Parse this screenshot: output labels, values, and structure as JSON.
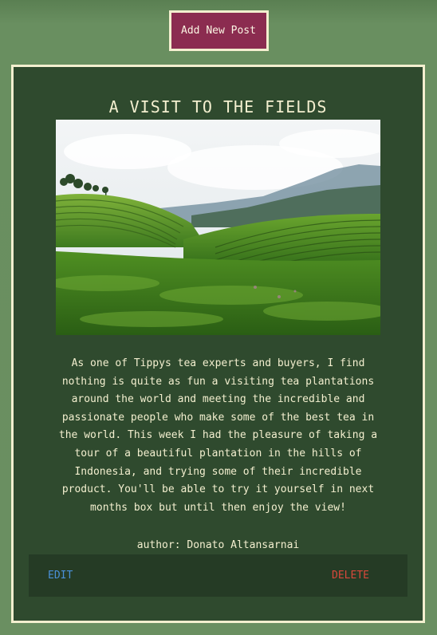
{
  "toolbar": {
    "add_post_label": "Add New Post"
  },
  "post": {
    "title": "A VISIT TO THE FIELDS",
    "body": "As one of Tippys tea experts and buyers, I find nothing is quite as fun a visiting tea plantations around the world and meeting the incredible and passionate people who make some of the best tea in the world. This week I had the pleasure of taking a tour of a beautiful plantation in the hills of Indonesia, and trying some of their incredible product. You'll be able to try it yourself in next months box but until then enjoy the view!",
    "author": "author: Donato Altansarnai",
    "edit_label": "EDIT",
    "delete_label": "DELETE"
  },
  "colors": {
    "background": "#6a8f61",
    "card": "#2f4a2e",
    "card_border": "#f3efcf",
    "button": "#8b2c50",
    "edit": "#4a90d9",
    "delete": "#d9483b"
  }
}
